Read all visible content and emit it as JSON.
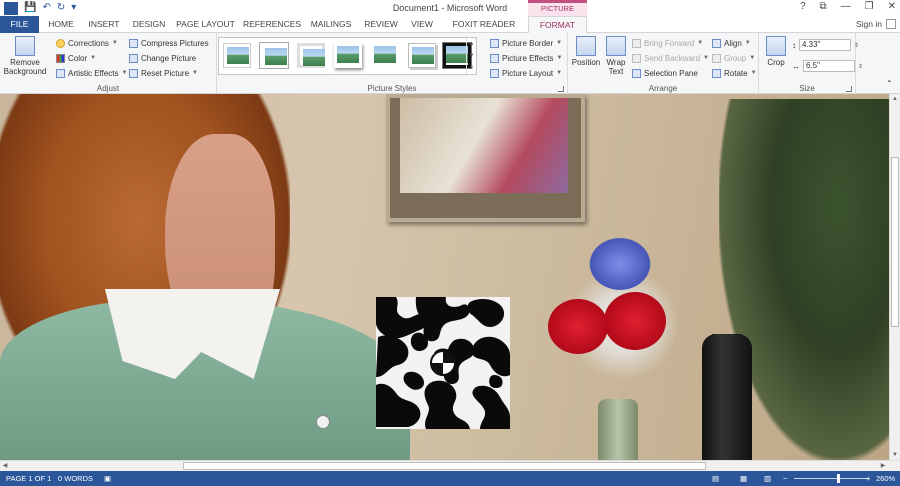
{
  "title_bar": {
    "document_title": "Document1 - Microsoft Word",
    "context_tab_group": "PICTURE TOOLS",
    "quick_access": [
      "save-icon",
      "undo-icon",
      "redo-icon",
      "customize-icon"
    ],
    "window_controls": [
      "?",
      "⧉",
      "—",
      "❐",
      "✕"
    ]
  },
  "tabs": {
    "file": "FILE",
    "items": [
      "HOME",
      "INSERT",
      "DESIGN",
      "PAGE LAYOUT",
      "REFERENCES",
      "MAILINGS",
      "REVIEW",
      "VIEW",
      "FOXIT READER PDF",
      "FORMAT"
    ],
    "active": "FORMAT",
    "sign_in": "Sign in"
  },
  "ribbon": {
    "adjust": {
      "label": "Adjust",
      "remove_background": "Remove Background",
      "corrections": "Corrections",
      "color": "Color",
      "artistic_effects": "Artistic Effects",
      "compress_pictures": "Compress Pictures",
      "change_picture": "Change Picture",
      "reset_picture": "Reset Picture"
    },
    "picture_styles": {
      "label": "Picture Styles",
      "picture_border": "Picture Border",
      "picture_effects": "Picture Effects",
      "picture_layout": "Picture Layout"
    },
    "arrange": {
      "label": "Arrange",
      "position": "Position",
      "wrap_text": "Wrap Text",
      "bring_forward": "Bring Forward",
      "send_backward": "Send Backward",
      "selection_pane": "Selection Pane",
      "align": "Align",
      "group": "Group",
      "rotate": "Rotate"
    },
    "size": {
      "label": "Size",
      "crop": "Crop",
      "height": "4.33\"",
      "width": "6.5\""
    }
  },
  "status_bar": {
    "page": "PAGE 1 OF 1",
    "words": "0 WORDS",
    "zoom": "260%",
    "zoom_minus": "−",
    "zoom_plus": "+"
  },
  "colors": {
    "accent": "#2b579a",
    "context": "#a0305f"
  }
}
